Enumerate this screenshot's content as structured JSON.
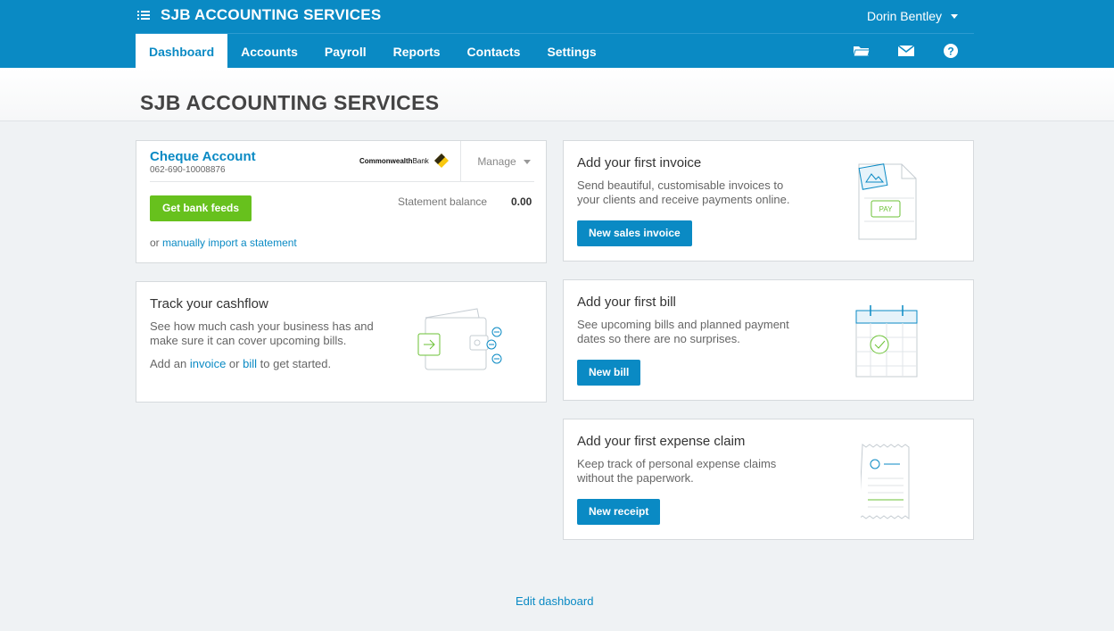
{
  "header": {
    "org_name": "SJB ACCOUNTING SERVICES",
    "user_name": "Dorin Bentley",
    "nav": [
      {
        "label": "Dashboard"
      },
      {
        "label": "Accounts"
      },
      {
        "label": "Payroll"
      },
      {
        "label": "Reports"
      },
      {
        "label": "Contacts"
      },
      {
        "label": "Settings"
      }
    ],
    "icons": [
      "files-icon",
      "mail-icon",
      "help-icon"
    ],
    "accent_color": "#0a8ac4"
  },
  "page_title": "SJB ACCOUNTING SERVICES",
  "bank_account": {
    "name": "Cheque Account",
    "number": "062-690-10008876",
    "bank_logo_bold": "Commonwealth",
    "bank_logo_light": "Bank",
    "manage_label": "Manage",
    "get_feeds_label": "Get bank feeds",
    "statement_label": "Statement balance",
    "statement_value": "0.00",
    "import_prefix": "or",
    "import_link": "manually import a statement"
  },
  "cashflow": {
    "title": "Track your cashflow",
    "description": "See how much cash your business has and make sure it can cover upcoming bills.",
    "cta_prefix": "Add an",
    "cta_invoice": "invoice",
    "cta_or": "or",
    "cta_bill": "bill",
    "cta_suffix": "to get started."
  },
  "invoice_card": {
    "title": "Add your first invoice",
    "description": "Send beautiful, customisable invoices to your clients and receive payments online.",
    "button": "New sales invoice",
    "illus_text": "PAY"
  },
  "bill_card": {
    "title": "Add your first bill",
    "description": "See upcoming bills and planned payment dates so there are no surprises.",
    "button": "New bill"
  },
  "expense_card": {
    "title": "Add your first expense claim",
    "description": "Keep track of personal expense claims without the paperwork.",
    "button": "New receipt"
  },
  "edit_dashboard": "Edit dashboard"
}
